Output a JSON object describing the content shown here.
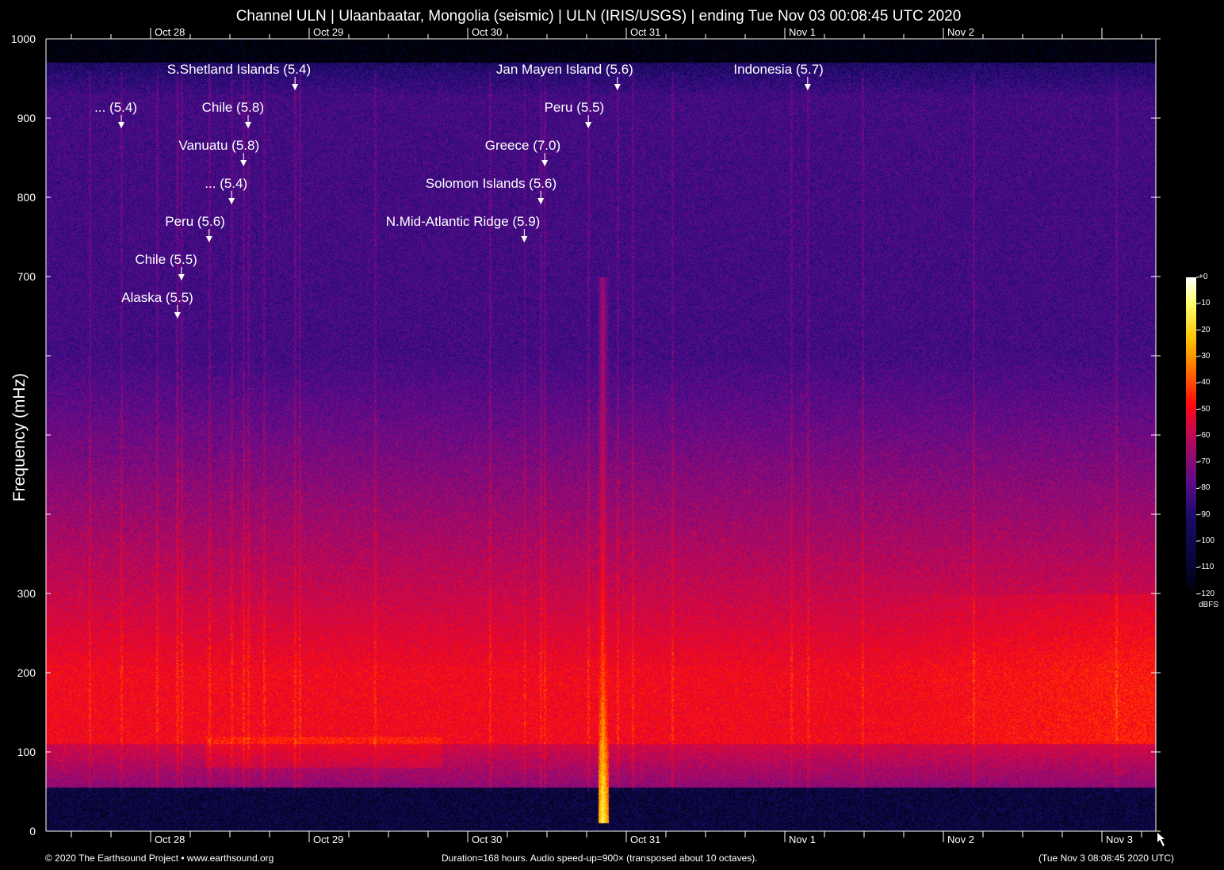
{
  "chart_data": {
    "type": "heatmap",
    "title": "Channel ULN | Ulaanbaatar, Mongolia (seismic) | ULN (IRIS/USGS) | ending Tue Nov 03 00:08:45 UTC 2020",
    "ylabel": "Frequency (mHz)",
    "ylim": [
      0,
      1000
    ],
    "y_tick_labels": [
      "0",
      "100",
      "200",
      "300",
      "700",
      "800",
      "900",
      "1000"
    ],
    "x_tick_labels_bottom": [
      "Oct 28",
      "Oct 29",
      "Oct 30",
      "Oct 31",
      "Nov  1",
      "Nov  2",
      "Nov  3"
    ],
    "x_tick_labels_top": [
      "Oct 28",
      "Oct 29",
      "Oct 30",
      "Oct 31",
      "Nov  1",
      "Nov  2"
    ],
    "duration_hours": 168,
    "colorbar": {
      "label": "dBFS",
      "range": [
        -120,
        0
      ],
      "ticks": [
        "+0",
        "-10",
        "-20",
        "-30",
        "-40",
        "-50",
        "-60",
        "-70",
        "-80",
        "-90",
        "-100",
        "-110",
        "-120"
      ]
    },
    "events": [
      {
        "label": "S.Shetland Islands (5.4)",
        "hour": 37.7
      },
      {
        "label": "Jan Mayen Island (5.6)",
        "hour": 86.5
      },
      {
        "label": "Indonesia (5.7)",
        "hour": 115.3
      },
      {
        "label": "... (5.4)",
        "hour": 11.4
      },
      {
        "label": "Chile (5.8)",
        "hour": 30.6
      },
      {
        "label": "Peru (5.5)",
        "hour": 82.1
      },
      {
        "label": "Vanuatu (5.8)",
        "hour": 29.9
      },
      {
        "label": "Greece (7.0)",
        "hour": 75.5
      },
      {
        "label": "... (5.4)",
        "hour": 28.1
      },
      {
        "label": "Solomon Islands (5.6)",
        "hour": 74.9
      },
      {
        "label": "Peru (5.6)",
        "hour": 24.7
      },
      {
        "label": "N.Mid-Atlantic Ridge (5.9)",
        "hour": 72.4
      },
      {
        "label": "Chile (5.5)",
        "hour": 20.5
      },
      {
        "label": "Alaska (5.5)",
        "hour": 19.9
      }
    ]
  },
  "footer": {
    "copyright": "© 2020 The Earthsound Project • www.earthsound.org",
    "info": "Duration=168 hours. Audio speed-up=900× (transposed about 10 octaves).",
    "end_time": "(Tue Nov  3 08:08:45 2020 UTC)"
  }
}
